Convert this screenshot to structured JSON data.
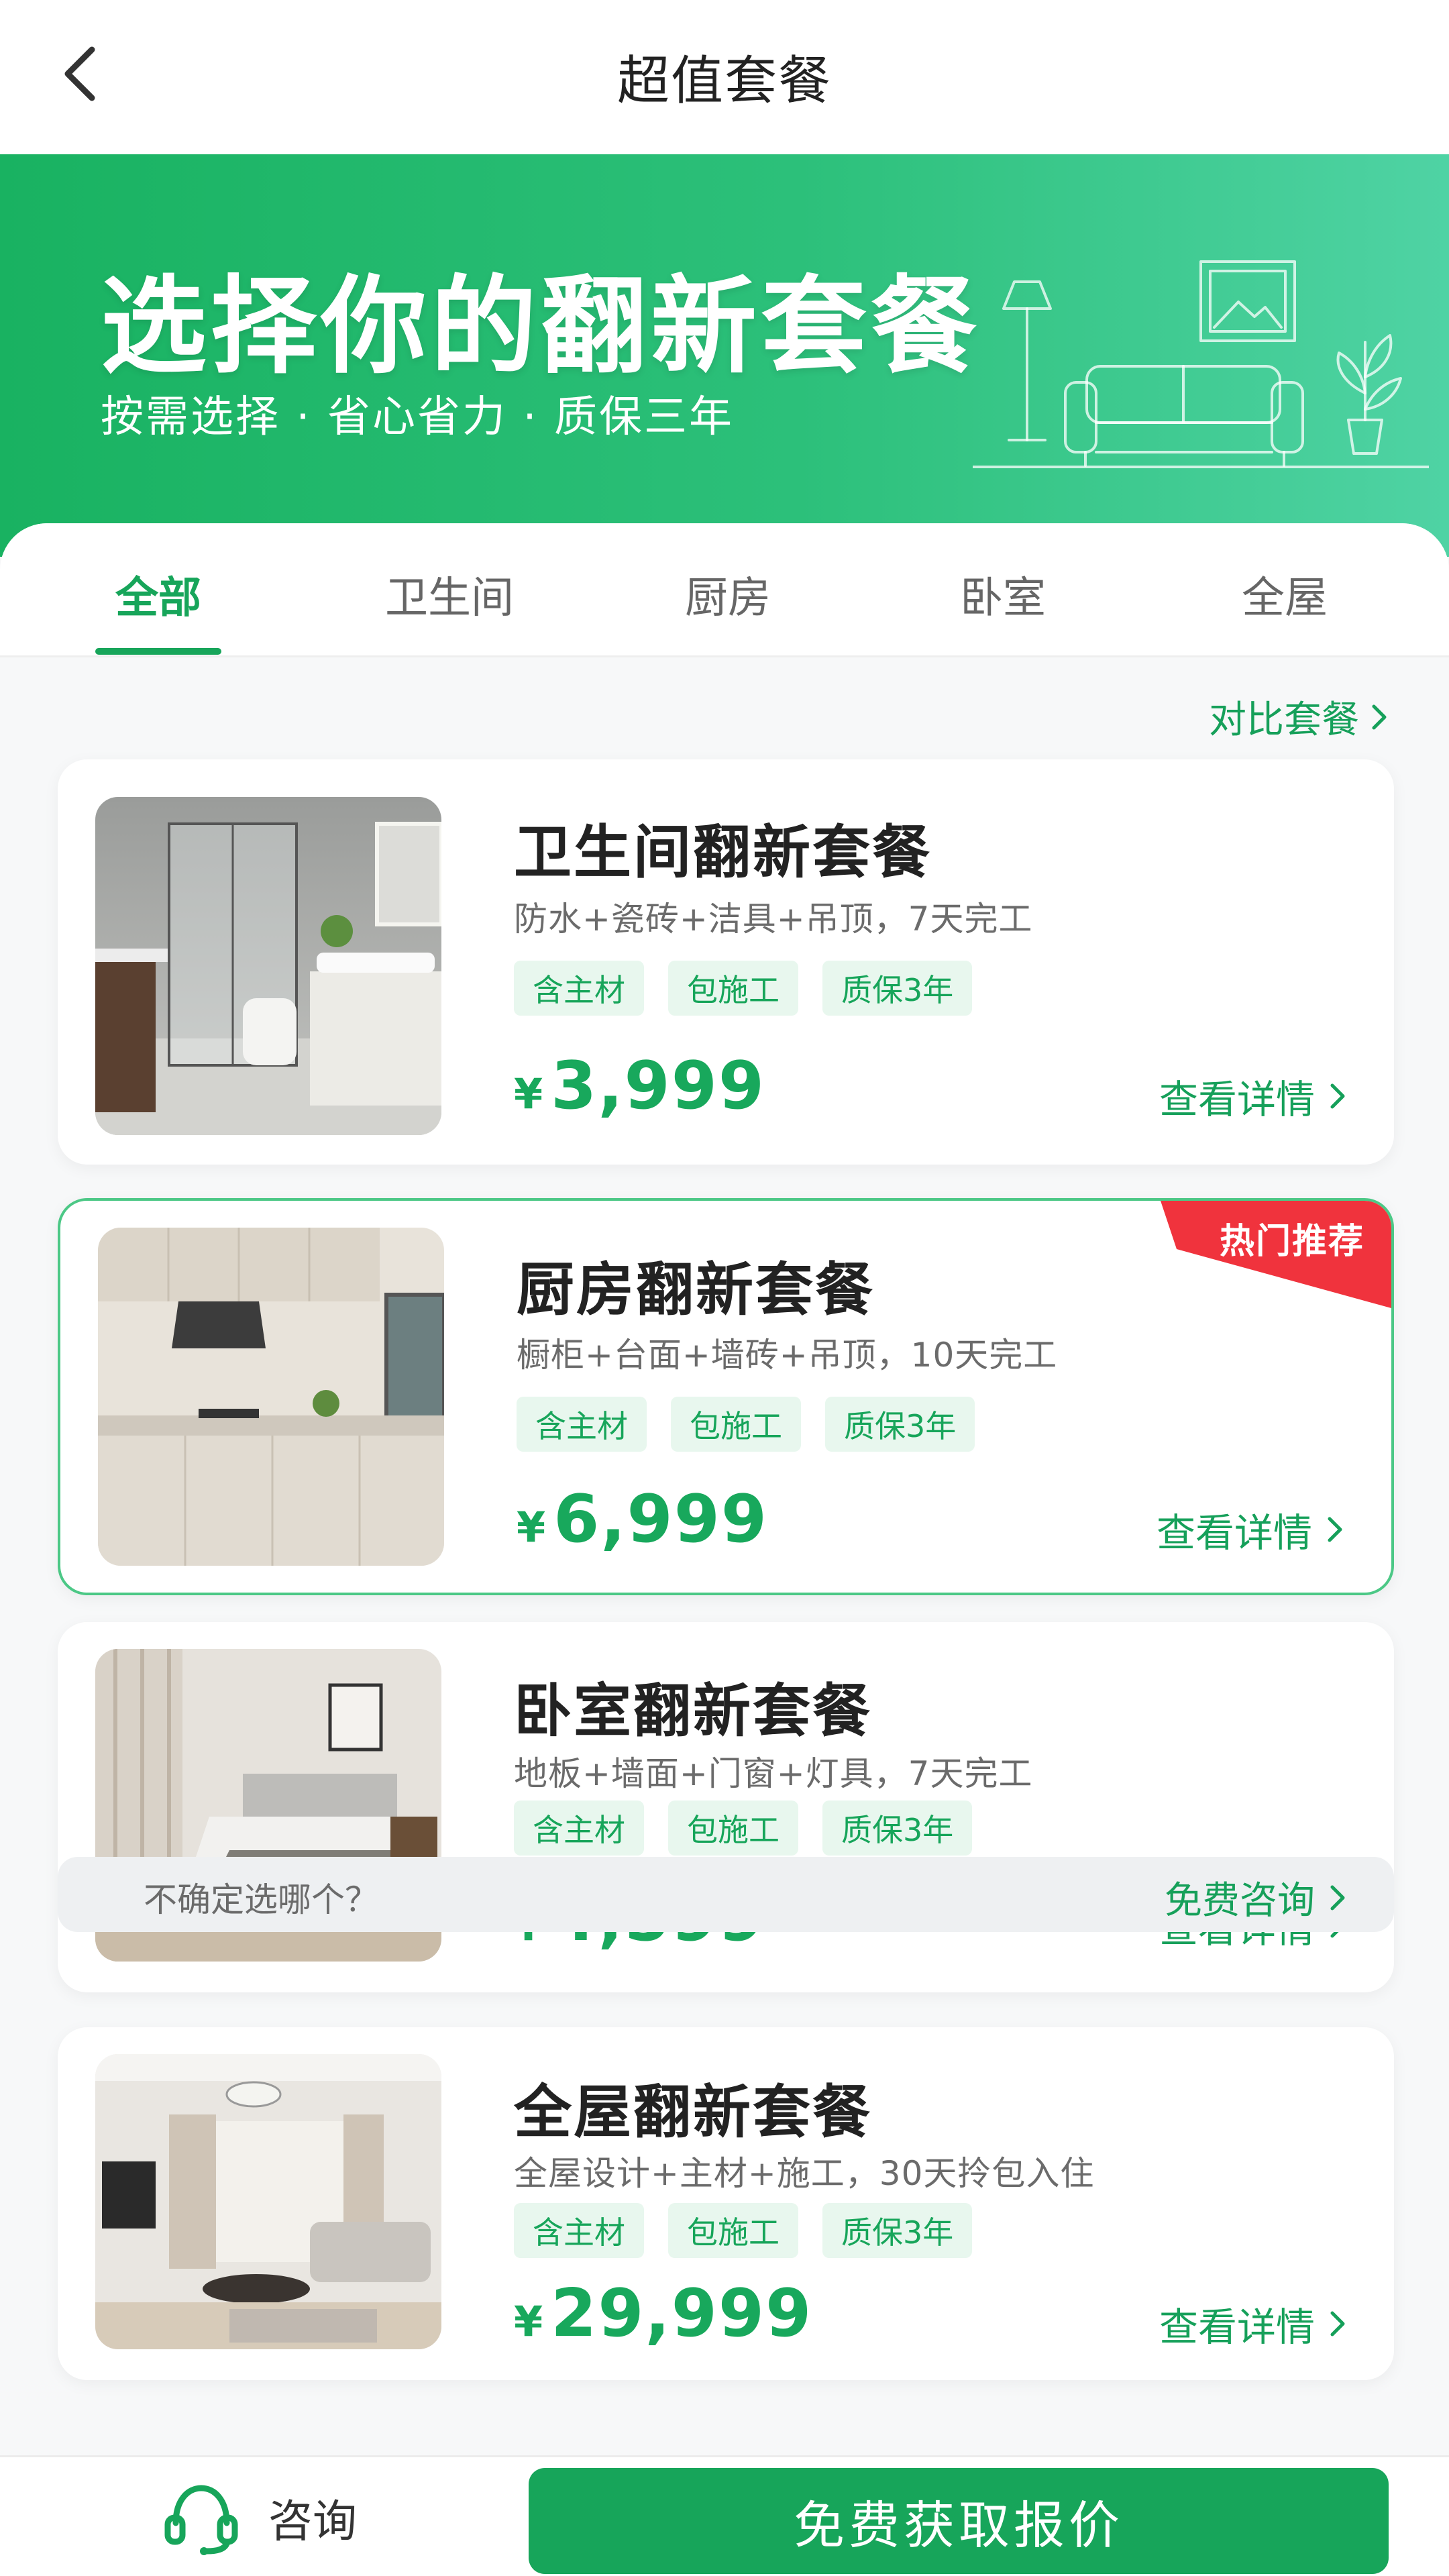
{
  "nav": {
    "title": "超值套餐"
  },
  "hero": {
    "title": "选择你的翻新套餐",
    "subtitle": "按需选择 · 省心省力 · 质保三年"
  },
  "tabs": [
    {
      "label": "全部",
      "active": true
    },
    {
      "label": "卫生间",
      "active": false
    },
    {
      "label": "厨房",
      "active": false
    },
    {
      "label": "卧室",
      "active": false
    },
    {
      "label": "全屋",
      "active": false
    }
  ],
  "compare_label": "对比套餐",
  "packages": [
    {
      "title": "卫生间翻新套餐",
      "desc": "防水+瓷砖+洁具+吊顶，7天完工",
      "tags": [
        "含主材",
        "包施工",
        "质保3年"
      ],
      "currency": "¥",
      "price": "3,999",
      "detail_label": "查看详情",
      "image": "bathroom-photo"
    },
    {
      "title": "厨房翻新套餐",
      "desc": "橱柜+台面+墙砖+吊顶，10天完工",
      "tags": [
        "含主材",
        "包施工",
        "质保3年"
      ],
      "currency": "¥",
      "price": "6,999",
      "detail_label": "查看详情",
      "badge": "热门推荐",
      "image": "kitchen-photo"
    },
    {
      "title": "卧室翻新套餐",
      "desc": "地板+墙面+门窗+灯具，7天完工",
      "tags": [
        "含主材",
        "包施工",
        "质保3年"
      ],
      "currency": "¥",
      "price": "4,599",
      "detail_label": "查看详情",
      "image": "bedroom-photo"
    },
    {
      "title": "全屋翻新套餐",
      "desc": "全屋设计+主材+施工，30天拎包入住",
      "tags": [
        "含主材",
        "包施工",
        "质保3年"
      ],
      "currency": "¥",
      "price": "29,999",
      "detail_label": "查看详情",
      "image": "living-room-photo"
    }
  ],
  "help": {
    "text": "不确定选哪个？",
    "link": "免费咨询"
  },
  "bottom": {
    "consult_label": "咨询",
    "quote_label": "免费获取报价"
  },
  "colors": {
    "brand_green": "#17a55a",
    "hot_red": "#f0333d",
    "tag_bg": "#e8f7ee"
  },
  "icons": [
    "back-arrow-icon",
    "chevron-right-icon",
    "headset-icon",
    "lamp-icon",
    "sofa-icon",
    "plant-icon",
    "picture-frame-icon"
  ]
}
